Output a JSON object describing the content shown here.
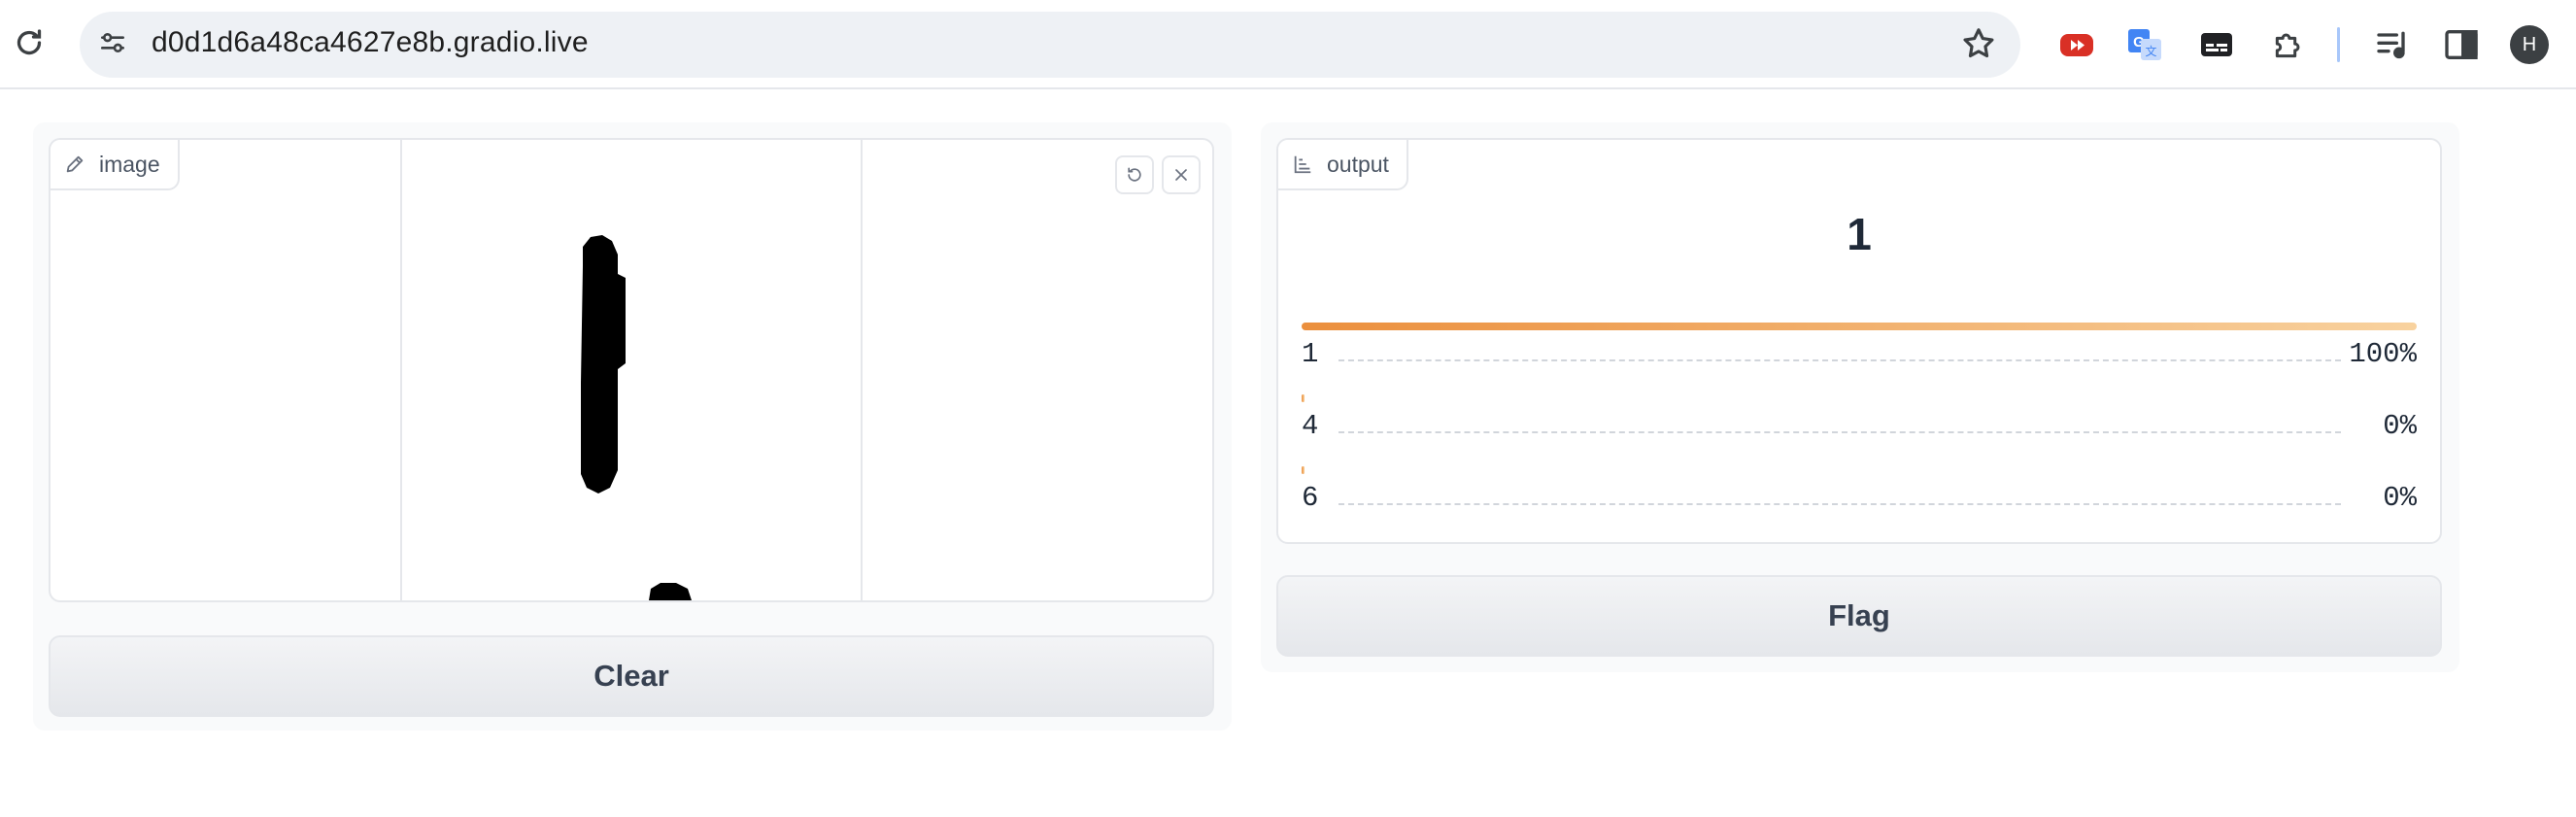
{
  "browser": {
    "url": "d0d1d6a48ca4627e8b.gradio.live",
    "avatar_letter": "H",
    "icons": [
      "reload-icon",
      "site-info-icon",
      "bookmark-star-icon",
      "youtube-extension-icon",
      "google-translate-extension-icon",
      "captions-extension-icon",
      "extensions-puzzle-icon",
      "media-controls-icon",
      "side-panel-icon"
    ]
  },
  "input": {
    "label": "image",
    "icon": "pencil-icon",
    "tools": [
      "undo-icon",
      "close-icon"
    ]
  },
  "output": {
    "label": "output",
    "icon": "label-icon",
    "top_label": "1",
    "confidences": [
      {
        "label": "1",
        "value": "100%",
        "fraction": 1.0
      },
      {
        "label": "4",
        "value": "0%",
        "fraction": 0.0
      },
      {
        "label": "6",
        "value": "0%",
        "fraction": 0.0
      }
    ]
  },
  "buttons": {
    "clear": "Clear",
    "flag": "Flag"
  },
  "colors": {
    "confidence_bar_start": "#eb8f3d",
    "confidence_bar_end": "#f8d29f",
    "panel_bg": "#f9fafb",
    "border": "#e5e7eb"
  }
}
